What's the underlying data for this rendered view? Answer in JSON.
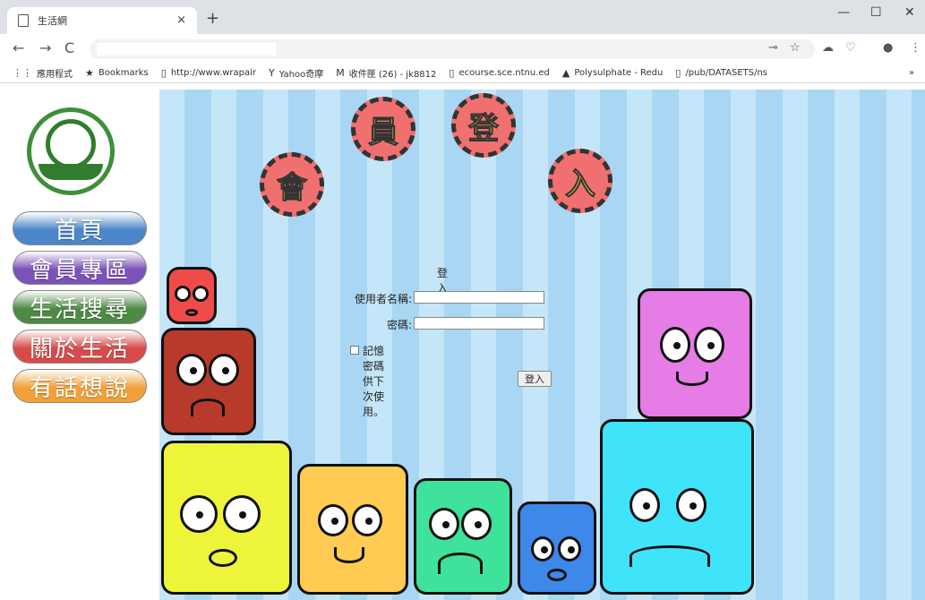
{
  "browser": {
    "tab_title": "生活網",
    "tab_close": "×",
    "new_tab": "+",
    "win_min": "—",
    "win_max": "☐",
    "win_close": "✕",
    "nav_back": "←",
    "nav_forward": "→",
    "nav_reload": "C",
    "bookmarks": [
      {
        "icon": "apps-icon",
        "glyph": "⋮⋮",
        "label": "應用程式"
      },
      {
        "icon": "star-icon",
        "glyph": "★",
        "label": "Bookmarks"
      },
      {
        "icon": "page-icon",
        "glyph": "▯",
        "label": "http://www.wrapair"
      },
      {
        "icon": "yahoo-icon",
        "glyph": "Y",
        "label": "Yahoo奇摩"
      },
      {
        "icon": "gmail-icon",
        "glyph": "M",
        "label": "收件匣 (26) - jk8812"
      },
      {
        "icon": "page-icon",
        "glyph": "▯",
        "label": "ecourse.sce.ntnu.ed"
      },
      {
        "icon": "triangle-icon",
        "glyph": "▲",
        "label": "Polysulphate - Redu"
      },
      {
        "icon": "page-icon",
        "glyph": "▯",
        "label": "/pub/DATASETS/ns"
      }
    ],
    "bookmarks_more": "»"
  },
  "sidebar": {
    "nav": [
      {
        "label": "首頁",
        "color": "#4a86c8"
      },
      {
        "label": "會員專區",
        "color": "#7a52b8"
      },
      {
        "label": "生活搜尋",
        "color": "#4e8a45"
      },
      {
        "label": "關於生活",
        "color": "#d84b4b"
      },
      {
        "label": "有話想說",
        "color": "#f2a13a"
      }
    ]
  },
  "banner": {
    "chars": [
      "會",
      "員",
      "登",
      "入"
    ]
  },
  "login": {
    "title": "登入",
    "username_label": "使用者名稱:",
    "password_label": "密碼:",
    "remember_label": "記憶密碼供下次使用。",
    "submit_label": "登入"
  },
  "colors": {
    "stripe_light": "#c4e6f8",
    "stripe_dark": "#a9d6f2",
    "gear": "#f07070",
    "gear_text": "#ffef3a"
  }
}
